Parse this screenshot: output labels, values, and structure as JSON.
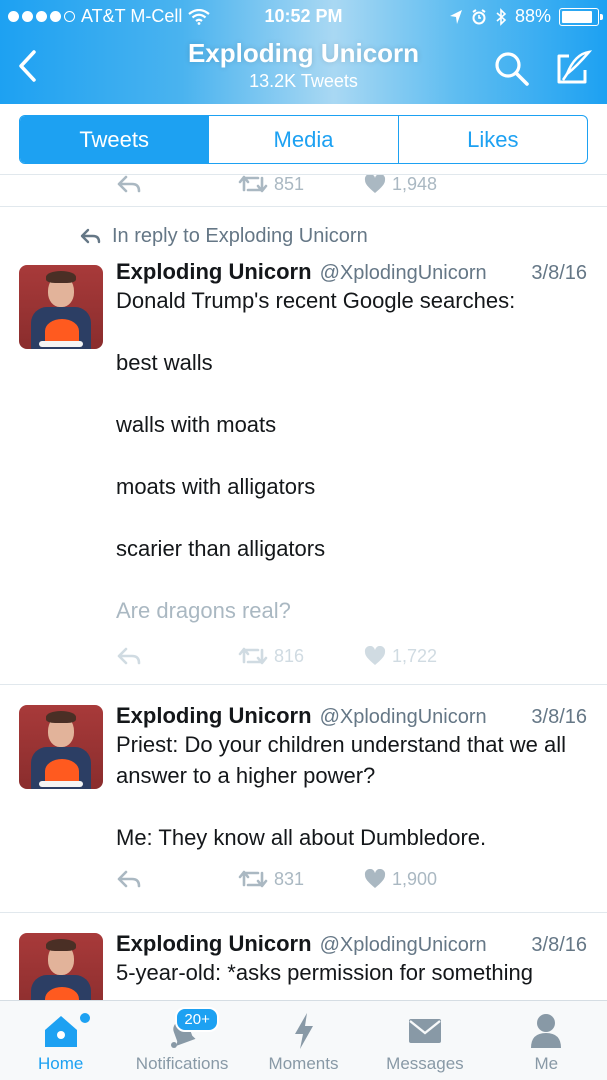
{
  "status_bar": {
    "carrier": "AT&T M-Cell",
    "time": "10:52 PM",
    "battery": "88%",
    "battery_level": 0.88
  },
  "header": {
    "title": "Exploding Unicorn",
    "subtitle": "13.2K Tweets",
    "icons": [
      "back-chevron-icon",
      "search-icon",
      "compose-tweet-icon"
    ]
  },
  "segment": {
    "tabs": [
      "Tweets",
      "Media",
      "Likes"
    ],
    "selected": "Tweets"
  },
  "top_partial": {
    "retweets": "851",
    "likes": "1,948"
  },
  "tweets": [
    {
      "reply_context": "In reply to Exploding Unicorn",
      "name": "Exploding Unicorn",
      "handle": "@XplodingUnicorn",
      "date": "3/8/16",
      "lines": [
        "Donald Trump's recent Google searches:",
        "best walls",
        "walls with moats",
        "moats with alligators",
        "scarier than alligators",
        "Are dragons real?"
      ],
      "retweets": "816",
      "likes": "1,722"
    },
    {
      "name": "Exploding Unicorn",
      "handle": "@XplodingUnicorn",
      "date": "3/8/16",
      "lines": [
        "Priest: Do your children understand that we all answer to a higher power?",
        "Me: They know all about Dumbledore."
      ],
      "retweets": "831",
      "likes": "1,900"
    },
    {
      "name": "Exploding Unicorn",
      "handle": "@XplodingUnicorn",
      "date": "3/8/16",
      "lines": [
        "5-year-old: *asks permission for something"
      ]
    }
  ],
  "tabbar": {
    "items": [
      {
        "label": "Home",
        "icon": "home-icon"
      },
      {
        "label": "Notifications",
        "icon": "bell-icon"
      },
      {
        "label": "Moments",
        "icon": "lightning-icon"
      },
      {
        "label": "Messages",
        "icon": "envelope-icon"
      },
      {
        "label": "Me",
        "icon": "person-icon"
      }
    ],
    "notifications_badge": "20+",
    "active": "Home"
  },
  "colors": {
    "accent": "#1da1f2",
    "muted": "#aab8c2",
    "text": "#14171a"
  }
}
